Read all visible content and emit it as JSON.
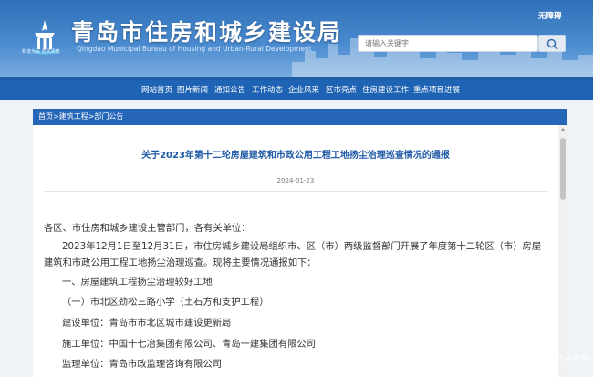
{
  "header": {
    "site_title": "青岛市住房和城乡建设局",
    "site_subtitle": "Qingdao Municipal Bureau of Housing and Urban-Rural Development",
    "logo_caption": "和谐为民 务实清廉",
    "accessibility_label": "无障碍",
    "search": {
      "placeholder": "请输入关键字"
    }
  },
  "nav": {
    "items": [
      {
        "label": "网站首页"
      },
      {
        "label": "图片新闻"
      },
      {
        "label": "通知公告"
      },
      {
        "label": "工作动态"
      },
      {
        "label": "企业风采"
      },
      {
        "label": "区市亮点"
      },
      {
        "label": "住房建设工作"
      },
      {
        "label": "重点项目进展"
      }
    ]
  },
  "breadcrumb": {
    "text": "首页>建筑工程>部门公告"
  },
  "article": {
    "title": "关于2023年第十二轮房屋建筑和市政公用工程工地扬尘治理巡查情况的通报",
    "date": "2024-01-23",
    "paragraphs": [
      "各区、市住房和城乡建设主管部门，各有关单位：",
      "2023年12月1日至12月31日，市住房城乡建设局组织市、区（市）两级监督部门开展了年度第十二轮区（市）房屋",
      "建筑和市政公用工程工地扬尘治理巡查。现将主要情况通报如下：",
      "一、房屋建筑工程扬尘治理较好工地",
      "（一）市北区劲松三路小学（土石方和支护工程）",
      "建设单位：青岛市市北区城市建设更新局",
      "施工单位：中国十七冶集团有限公司、青岛一建集团有限公司",
      "监理单位：青岛市政监理咨询有限公司"
    ]
  },
  "watermark": "文化视界",
  "colors": {
    "nav_bg": "#1f63b4",
    "title": "#1f5aa6",
    "header": "#3a7cc4"
  }
}
